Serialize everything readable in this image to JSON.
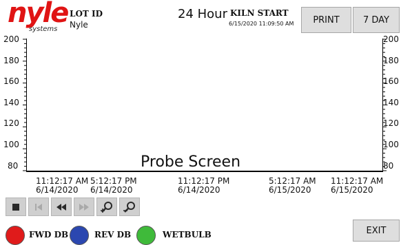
{
  "header": {
    "logo_text": "nyle",
    "logo_sub": "systems",
    "lot_label": "LOT ID",
    "lot_value": "Nyle",
    "hour_label": "24 Hour",
    "kiln_label": "KILN START",
    "kiln_date": "6/15/2020 11:09:50 AM",
    "print_label": "PRINT",
    "seven_day_label": "7 DAY"
  },
  "chart": {
    "title": "Probe Screen",
    "y_ticks": [
      "200",
      "180",
      "160",
      "140",
      "120",
      "100",
      "80"
    ],
    "x_ticks": [
      {
        "time": "11:12:17 AM",
        "date": "6/14/2020"
      },
      {
        "time": "5:12:17 PM",
        "date": "6/14/2020"
      },
      {
        "time": "11:12:17 PM",
        "date": "6/14/2020"
      },
      {
        "time": "5:12:17 AM",
        "date": "6/15/2020"
      },
      {
        "time": "11:12:17 AM",
        "date": "6/15/2020"
      }
    ]
  },
  "chart_data": {
    "type": "line",
    "title": "Probe Screen",
    "ylim": [
      80,
      200
    ],
    "y_ticks": [
      80,
      100,
      120,
      140,
      160,
      180,
      200
    ],
    "x_ticks": [
      "11:12:17 AM 6/14/2020",
      "5:12:17 PM 6/14/2020",
      "11:12:17 PM 6/14/2020",
      "5:12:17 AM 6/15/2020",
      "11:12:17 AM 6/15/2020"
    ],
    "series": [
      {
        "name": "FWD DB",
        "values": []
      },
      {
        "name": "REV DB",
        "values": []
      },
      {
        "name": "WETBULB",
        "values": []
      }
    ],
    "grid": false
  },
  "nav": {
    "icons": [
      "stop-icon",
      "skip-back-icon",
      "rewind-icon",
      "fast-forward-icon",
      "zoom-in-icon",
      "zoom-out-icon"
    ]
  },
  "legend": {
    "items": [
      {
        "label": "FWD DB",
        "color": "#e01b1b"
      },
      {
        "label": "REV DB",
        "color": "#2b47b0"
      },
      {
        "label": "WETBULB",
        "color": "#3fba3a"
      }
    ]
  },
  "exit_label": "EXIT"
}
